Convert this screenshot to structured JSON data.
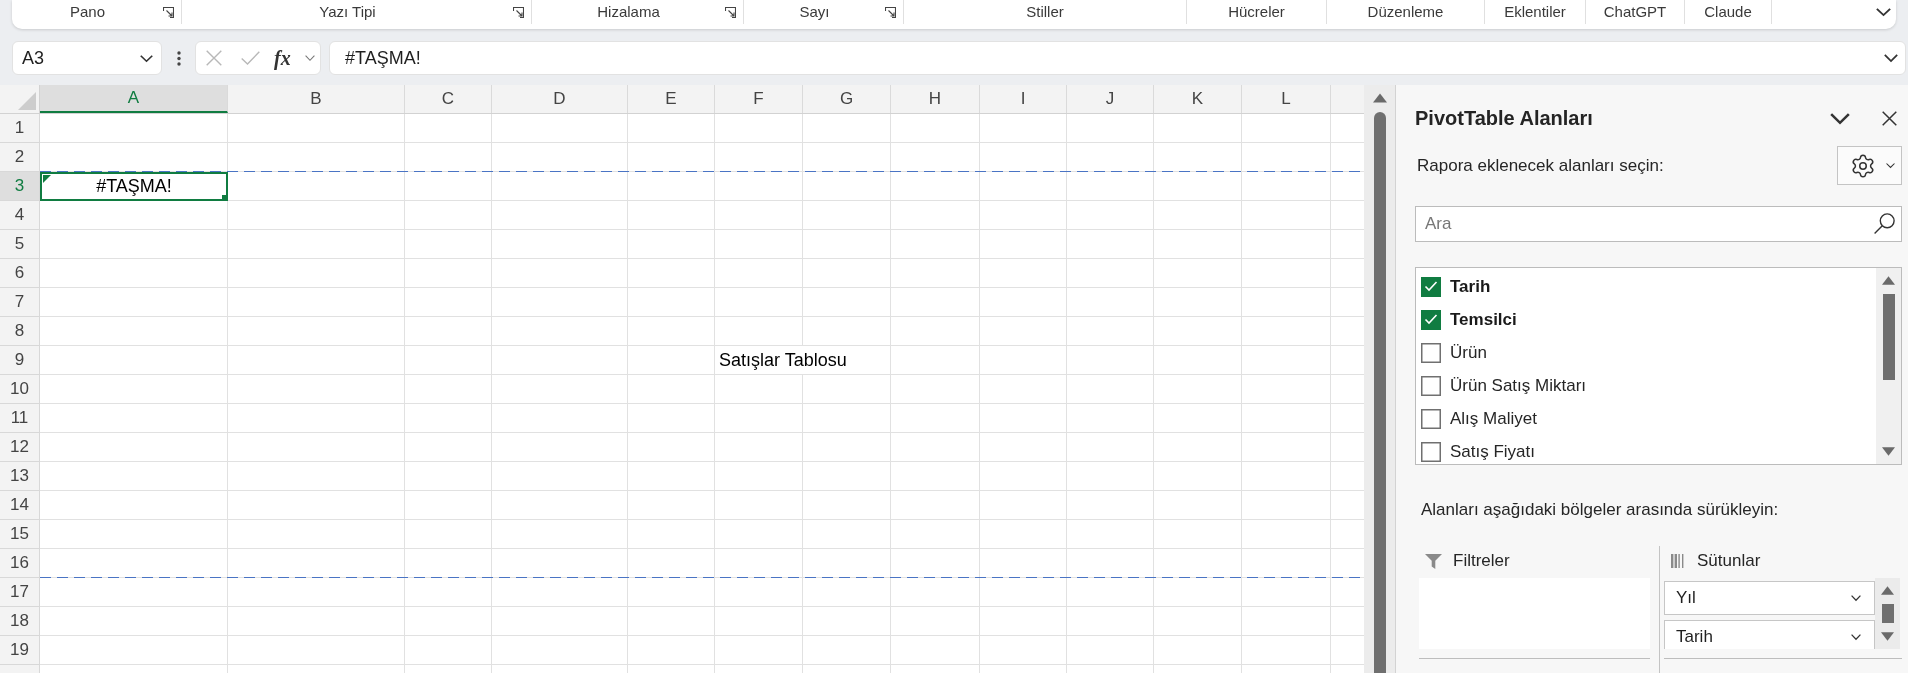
{
  "ribbon": {
    "groups": [
      {
        "label": "Pano",
        "launcher": true
      },
      {
        "label": "Yazı Tipi",
        "launcher": true
      },
      {
        "label": "Hizalama",
        "launcher": true
      },
      {
        "label": "Sayı",
        "launcher": true
      },
      {
        "label": "Stiller",
        "launcher": false
      },
      {
        "label": "Hücreler",
        "launcher": false
      },
      {
        "label": "Düzenleme",
        "launcher": false
      },
      {
        "label": "Eklentiler",
        "launcher": false
      },
      {
        "label": "ChatGPT",
        "launcher": false
      },
      {
        "label": "Claude",
        "launcher": false
      }
    ]
  },
  "formula_bar": {
    "name_box": "A3",
    "function_button": "fx",
    "formula": "#TAŞMA!"
  },
  "sheet": {
    "columns": [
      {
        "label": "A",
        "selected": true
      },
      {
        "label": "B",
        "selected": false
      },
      {
        "label": "C",
        "selected": false
      },
      {
        "label": "D",
        "selected": false
      },
      {
        "label": "E",
        "selected": false
      },
      {
        "label": "F",
        "selected": false
      },
      {
        "label": "G",
        "selected": false
      },
      {
        "label": "H",
        "selected": false
      },
      {
        "label": "I",
        "selected": false
      },
      {
        "label": "J",
        "selected": false
      },
      {
        "label": "K",
        "selected": false
      },
      {
        "label": "L",
        "selected": false
      }
    ],
    "rows": [
      {
        "label": "1",
        "selected": false,
        "page_break": false
      },
      {
        "label": "2",
        "selected": false,
        "page_break": false
      },
      {
        "label": "3",
        "selected": true,
        "page_break": true,
        "cells": [
          {
            "kind": "error",
            "text": "#TAŞMA!",
            "selected": true
          }
        ]
      },
      {
        "label": "4",
        "selected": false,
        "page_break": false
      },
      {
        "label": "5",
        "selected": false,
        "page_break": false
      },
      {
        "label": "6",
        "selected": false,
        "page_break": false
      },
      {
        "label": "7",
        "selected": false,
        "page_break": false
      },
      {
        "label": "8",
        "selected": false,
        "page_break": false
      },
      {
        "label": "9",
        "selected": false,
        "page_break": false,
        "cells": [
          null,
          null,
          null,
          null,
          null,
          {
            "kind": "text",
            "text": "Satışlar Tablosu",
            "selected": false
          }
        ]
      },
      {
        "label": "10",
        "selected": false,
        "page_break": false
      },
      {
        "label": "11",
        "selected": false,
        "page_break": false
      },
      {
        "label": "12",
        "selected": false,
        "page_break": false
      },
      {
        "label": "13",
        "selected": false,
        "page_break": false
      },
      {
        "label": "14",
        "selected": false,
        "page_break": false
      },
      {
        "label": "15",
        "selected": false,
        "page_break": false
      },
      {
        "label": "16",
        "selected": false,
        "page_break": false
      },
      {
        "label": "17",
        "selected": false,
        "page_break": true
      },
      {
        "label": "18",
        "selected": false,
        "page_break": false
      },
      {
        "label": "19",
        "selected": false,
        "page_break": false
      }
    ]
  },
  "pivot_panel": {
    "title": "PivotTable Alanları",
    "instruction": "Rapora eklenecek alanları seçin:",
    "search": {
      "placeholder": "Ara"
    },
    "fields": [
      {
        "label": "Tarih",
        "checked": true
      },
      {
        "label": "Temsilci",
        "checked": true
      },
      {
        "label": "Ürün",
        "checked": false
      },
      {
        "label": "Ürün Satış Miktarı",
        "checked": false
      },
      {
        "label": "Alış Maliyet",
        "checked": false
      },
      {
        "label": "Satış Fiyatı",
        "checked": false
      }
    ],
    "areas_hint": "Alanları aşağıdaki bölgeler arasında sürükleyin:",
    "areas": [
      {
        "kind": "filters",
        "label": "Filtreler"
      },
      {
        "kind": "columns",
        "label": "Sütunlar",
        "items": [
          "Yıl",
          "Tarih"
        ]
      }
    ]
  }
}
